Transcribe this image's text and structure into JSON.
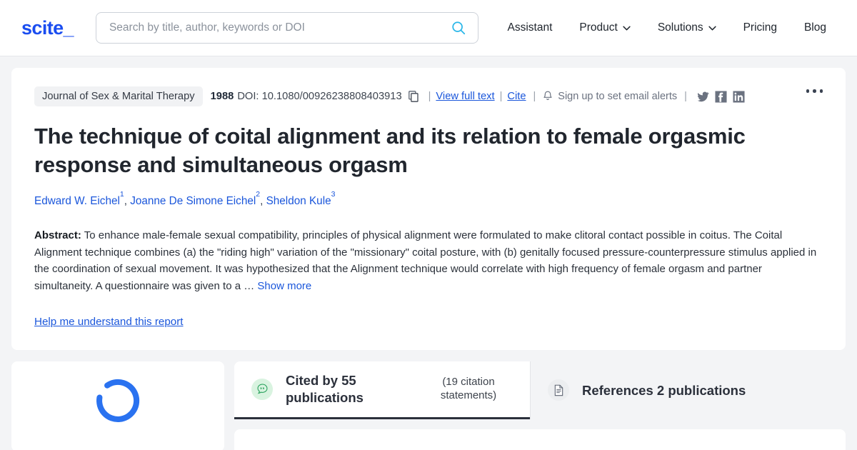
{
  "header": {
    "logo": "scite_",
    "search": {
      "placeholder": "Search by title, author, keywords or DOI",
      "value": "",
      "icon": "search-icon"
    },
    "nav": [
      {
        "label": "Assistant",
        "has_caret": false
      },
      {
        "label": "Product",
        "has_caret": true
      },
      {
        "label": "Solutions",
        "has_caret": true
      },
      {
        "label": "Pricing",
        "has_caret": false
      },
      {
        "label": "Blog",
        "has_caret": false
      }
    ]
  },
  "paper": {
    "journal": "Journal of Sex & Marital Therapy",
    "year": "1988",
    "doi": "DOI: 10.1080/00926238808403913",
    "copy_icon": "copy-icon",
    "separator": "|",
    "view_full_text": "View full text",
    "cite": "Cite",
    "bell_icon": "bell-icon",
    "email_alerts": "Sign up to set email alerts",
    "socials": [
      {
        "name": "twitter-icon"
      },
      {
        "name": "facebook-icon"
      },
      {
        "name": "linkedin-icon"
      }
    ],
    "more_menu": "…",
    "title": "The technique of coital alignment and its relation to female orgasmic response and simultaneous orgasm",
    "authors": [
      {
        "name": "Edward W. Eichel",
        "affiliation": "1"
      },
      {
        "name": "Joanne De Simone Eichel",
        "affiliation": "2"
      },
      {
        "name": "Sheldon Kule",
        "affiliation": "3"
      }
    ],
    "abstract_label": "Abstract:",
    "abstract_text": "To enhance male-female sexual compatibility, principles of physical alignment were formulated to make clitoral contact possible in coitus. The Coital Alignment technique combines (a) the \"riding high\" variation of the \"missionary\" coital posture, with (b) genitally focused pressure-counterpressure stimulus applied in the coordination of sexual movement. It was hypothesized that the Alignment technique would correlate with high frequency of female orgasm and partner simultaneity. A questionnaire was given to a …",
    "show_more": "Show more",
    "help_link": "Help me understand this report"
  },
  "bottom": {
    "loading_spinner": "loading-spinner",
    "tabs": [
      {
        "id": "cited-by",
        "icon": "quote-bubble-icon",
        "label": "Cited by 55 publications",
        "sub": "(19 citation statements)",
        "active": true
      },
      {
        "id": "references",
        "icon": "document-icon",
        "label": "References 2 publications",
        "sub": "",
        "active": false
      }
    ]
  },
  "colors": {
    "brand_blue": "#1a4df0",
    "link_blue": "#1a56db",
    "search_icon_blue": "#29b6e8",
    "text_dark": "#21262e",
    "muted": "#6b7280",
    "page_bg": "#f3f4f6",
    "green_badge": "#d9f3e0",
    "tab_active_border": "#2b303b"
  }
}
